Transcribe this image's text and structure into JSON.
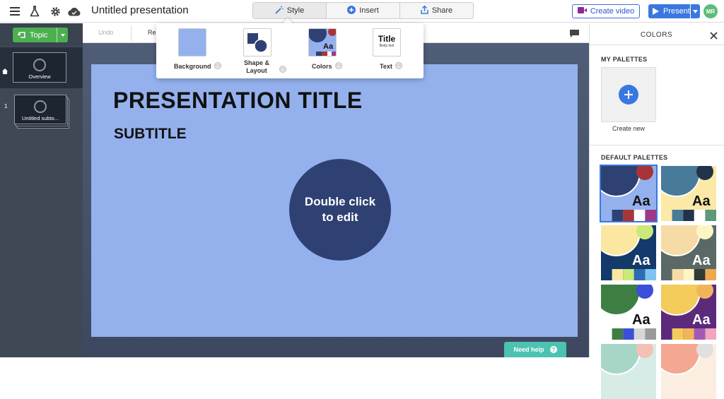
{
  "app": {
    "title": "Untitled presentation"
  },
  "tabs": [
    {
      "label": "Style",
      "active": true
    },
    {
      "label": "Insert",
      "active": false
    },
    {
      "label": "Share",
      "active": false
    }
  ],
  "buttons": {
    "create_video": "Create video",
    "present": "Present",
    "avatar": "MR",
    "topic": "Topic"
  },
  "toolbar": {
    "undo": "Undo",
    "redo": "Re"
  },
  "thumbnails": [
    {
      "number": "",
      "label": "Overview"
    },
    {
      "number": "1",
      "label": "Untitled subto..."
    }
  ],
  "slide": {
    "title": "PRESENTATION TITLE",
    "subtitle": "SUBTITLE",
    "circle_line1": "Double click",
    "circle_line2": "to edit",
    "bg_color": "#94b1ee",
    "circle_color": "#2f4173"
  },
  "style_menu": {
    "items": [
      {
        "label": "Background"
      },
      {
        "label": "Shape &\nLayout"
      },
      {
        "label": "Colors"
      },
      {
        "label": "Text"
      }
    ],
    "text_preview_title": "Title",
    "text_preview_body": "Body text",
    "preview_text": "Aa"
  },
  "colors_panel": {
    "title": "COLORS",
    "my_palettes": "MY PALETTES",
    "create_new": "Create new",
    "default_palettes": "DEFAULT PALETTES",
    "sample_text": "Aa"
  },
  "need_help": "Need help",
  "palettes": [
    {
      "bg": "#94b1ee",
      "circle": "#2f4173",
      "accent": "#a83535",
      "dark": "#2f4173",
      "swatches": [
        "#94b1ee",
        "#2f4173",
        "#a83535",
        "#ffffff",
        "#9b3a86"
      ],
      "selected": true
    },
    {
      "bg": "#fbe9a8",
      "circle": "#487a99",
      "accent": "#23344a",
      "dark": "#487a99",
      "swatches": [
        "#fbe9a8",
        "#487a99",
        "#23344a",
        "#ffffff",
        "#5b9a7a"
      ],
      "selected": false
    },
    {
      "bg": "#133a6a",
      "circle": "#fbe7a0",
      "accent": "#cbe97a",
      "dark": "#133a6a",
      "swatches": [
        "#133a6a",
        "#fbe7a0",
        "#cbe97a",
        "#2f6cb3",
        "#7fc4f0"
      ],
      "selected": false
    },
    {
      "bg": "#5b6966",
      "circle": "#f6dba6",
      "accent": "#fdf5c4",
      "dark": "#5b6966",
      "swatches": [
        "#5b6966",
        "#f6dba6",
        "#fdf5c4",
        "#323a38",
        "#f0a84e"
      ],
      "selected": false
    },
    {
      "bg": "#ffffff",
      "circle": "#3f7e43",
      "accent": "#3b4fd9",
      "dark": "#ffffff",
      "swatches": [
        "#ffffff",
        "#3f7e43",
        "#3b4fd9",
        "#d6d6d6",
        "#9a9a9a"
      ],
      "selected": false
    },
    {
      "bg": "#5b2a7a",
      "circle": "#f3cc5c",
      "accent": "#f0b55a",
      "dark": "#5b2a7a",
      "swatches": [
        "#5b2a7a",
        "#f3cc5c",
        "#f0b55a",
        "#a35ab7",
        "#f4a3c0"
      ],
      "selected": false
    },
    {
      "bg": "#d7ece7",
      "circle": "#a7d6c6",
      "accent": "#f4c2b5",
      "dark": "#d7ece7",
      "swatches": [],
      "selected": false
    },
    {
      "bg": "#fbeee0",
      "circle": "#f4a891",
      "accent": "#e0e0e0",
      "dark": "#fbeee0",
      "swatches": [],
      "selected": false
    }
  ]
}
